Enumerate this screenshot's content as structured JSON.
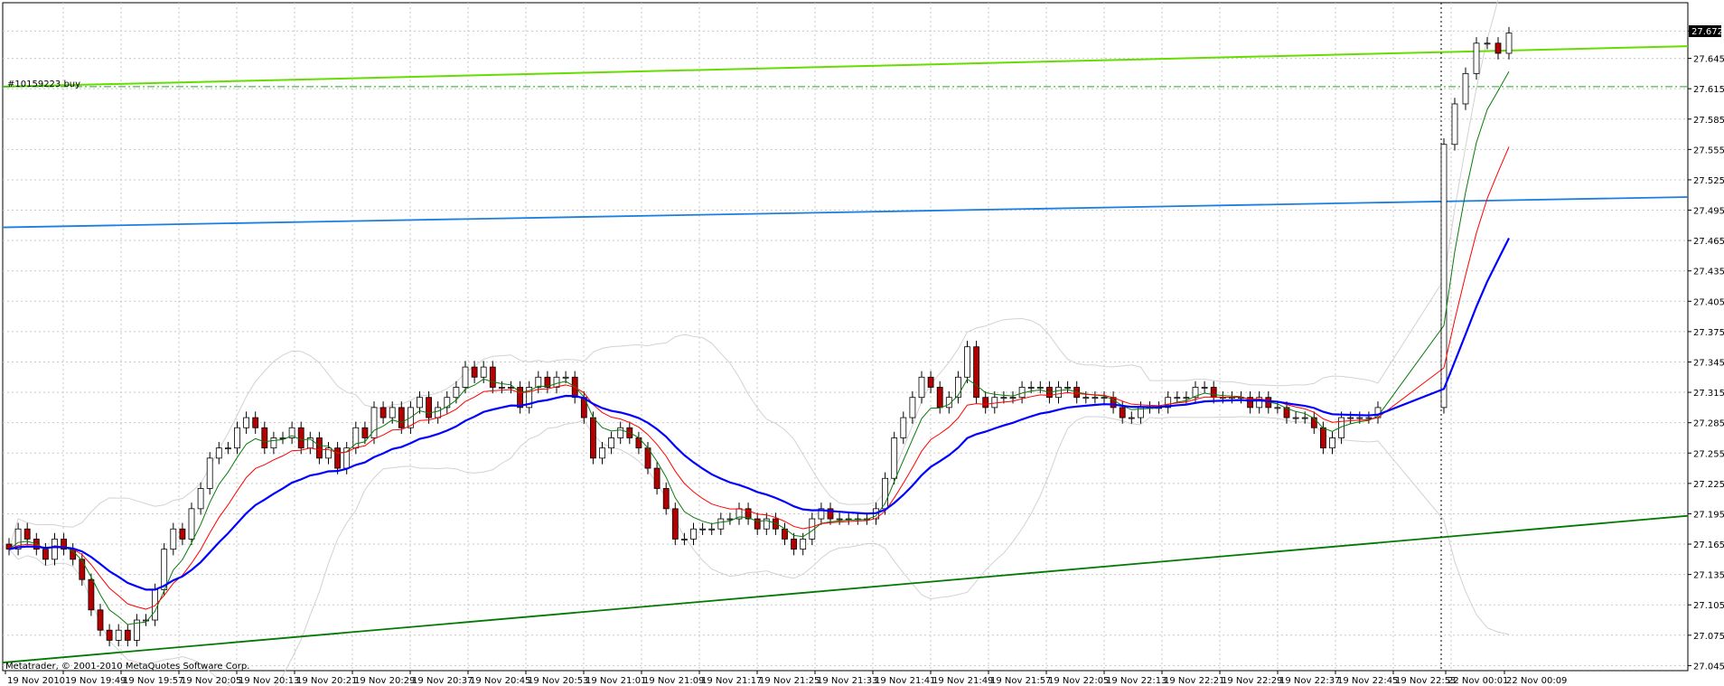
{
  "chart_data": {
    "type": "candlestick",
    "symbol_order_label": "#10159223 buy",
    "watermark": "Metatrader, © 2001-2010 MetaQuotes Software Corp.",
    "current_price": "27.672",
    "y_ticks": [
      "27.672",
      "27.645",
      "27.615",
      "27.585",
      "27.555",
      "27.525",
      "27.495",
      "27.465",
      "27.435",
      "27.405",
      "27.375",
      "27.345",
      "27.315",
      "27.285",
      "27.255",
      "27.225",
      "27.195",
      "27.165",
      "27.135",
      "27.105",
      "27.075",
      "27.045"
    ],
    "ylim": [
      27.04,
      27.7
    ],
    "x_ticks": [
      "19 Nov 2010",
      "19 Nov 19:49",
      "19 Nov 19:57",
      "19 Nov 20:05",
      "19 Nov 20:13",
      "19 Nov 20:21",
      "19 Nov 20:29",
      "19 Nov 20:37",
      "19 Nov 20:45",
      "19 Nov 20:53",
      "19 Nov 21:01",
      "19 Nov 21:09",
      "19 Nov 21:17",
      "19 Nov 21:25",
      "19 Nov 21:33",
      "19 Nov 21:41",
      "19 Nov 21:49",
      "19 Nov 21:57",
      "19 Nov 22:05",
      "19 Nov 22:13",
      "19 Nov 22:21",
      "19 Nov 22:29",
      "19 Nov 22:37",
      "19 Nov 22:45",
      "19 Nov 22:53",
      "22 Nov 00:01",
      "22 Nov 00:09"
    ],
    "close": [
      27.16,
      27.18,
      27.17,
      27.16,
      27.15,
      27.17,
      27.16,
      27.15,
      27.13,
      27.1,
      27.08,
      27.07,
      27.08,
      27.07,
      27.09,
      27.09,
      27.12,
      27.16,
      27.18,
      27.17,
      27.2,
      27.22,
      27.25,
      27.26,
      27.26,
      27.28,
      27.29,
      27.28,
      27.26,
      27.27,
      27.27,
      27.28,
      27.26,
      27.27,
      27.25,
      27.26,
      27.24,
      27.26,
      27.28,
      27.27,
      27.3,
      27.29,
      27.3,
      27.28,
      27.3,
      27.31,
      27.29,
      27.3,
      27.31,
      27.32,
      27.34,
      27.33,
      27.34,
      27.32,
      27.32,
      27.32,
      27.3,
      27.32,
      27.33,
      27.32,
      27.33,
      27.33,
      27.31,
      27.29,
      27.25,
      27.26,
      27.27,
      27.28,
      27.27,
      27.26,
      27.24,
      27.22,
      27.2,
      27.17,
      27.17,
      27.18,
      27.18,
      27.18,
      27.19,
      27.19,
      27.2,
      27.19,
      27.18,
      27.19,
      27.18,
      27.17,
      27.16,
      27.17,
      27.19,
      27.2,
      27.19,
      27.19,
      27.19,
      27.19,
      27.19,
      27.2,
      27.23,
      27.27,
      27.29,
      27.31,
      27.33,
      27.32,
      27.3,
      27.31,
      27.33,
      27.36,
      27.31,
      27.3,
      27.31,
      27.31,
      27.31,
      27.32,
      27.32,
      27.32,
      27.31,
      27.32,
      27.32,
      27.31,
      27.31,
      27.31,
      27.31,
      27.3,
      27.29,
      27.29,
      27.3,
      27.3,
      27.3,
      27.31,
      27.31,
      27.31,
      27.32,
      27.32,
      27.31,
      27.31,
      27.31,
      27.31,
      27.3,
      27.31,
      27.3,
      27.3,
      27.29,
      27.29,
      27.29,
      27.28,
      27.26,
      27.27,
      27.29,
      27.29,
      27.29,
      27.29,
      27.3,
      27.56,
      27.6,
      27.63,
      27.66,
      27.66,
      27.65,
      27.67
    ],
    "overlays": {
      "ma_fast": "green",
      "ma_mid": "red",
      "ma_slow": "blue",
      "bollinger": "light gray",
      "channel_top": "light green",
      "channel_mid": "blue",
      "channel_bottom": "dark green",
      "order_line": "dash-dot green"
    },
    "colors": {
      "bull": "#ffffff",
      "bear": "#b30000",
      "channel_top": "#66dd00",
      "channel_mid": "#1a7fe0",
      "channel_bottom": "#007a00",
      "ma_fast": "#0a7a0a",
      "ma_mid": "#ff0000",
      "ma_slow": "#0000ff",
      "bands": "#d2d2d2",
      "order": "#22aa22"
    }
  }
}
